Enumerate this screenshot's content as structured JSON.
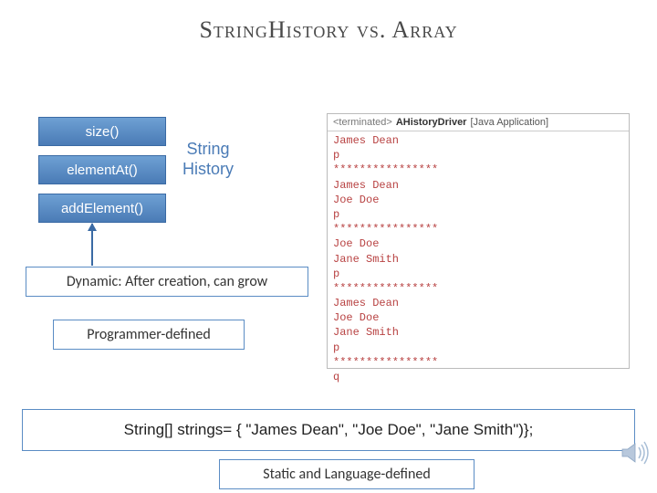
{
  "title": "StringHistory vs. Array",
  "methods": {
    "size": "size()",
    "elementAt": "elementAt()",
    "addElement": "addElement()"
  },
  "stringHistoryLabel": "String\nHistory",
  "notes": {
    "dynamic": "Dynamic: After creation, can grow",
    "programmerDefined": "Programmer-defined",
    "staticLang": "Static and Language-defined"
  },
  "codeLine": "String[] strings= { \"James Dean\", \"Joe Doe\", \"Jane Smith\")};",
  "console": {
    "terminated": "<terminated>",
    "driver": "AHistoryDriver",
    "appType": "[Java Application]",
    "lines": [
      "James Dean",
      "p",
      "****************",
      "James Dean",
      "Joe Doe",
      "p",
      "****************",
      "Joe Doe",
      "Jane Smith",
      "p",
      "****************",
      "James Dean",
      "Joe Doe",
      "Jane Smith",
      "p",
      "****************",
      "q"
    ]
  }
}
